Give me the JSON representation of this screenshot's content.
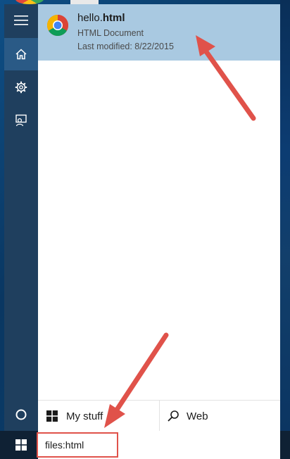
{
  "search_results": {
    "top_result": {
      "title_normal": "hello.",
      "title_bold": "html",
      "type": "HTML Document",
      "last_modified": "Last modified: 8/22/2015",
      "icon": "chrome-icon"
    }
  },
  "rail": {
    "items": [
      {
        "name": "hamburger-menu",
        "icon": "hamburger-icon"
      },
      {
        "name": "home",
        "icon": "home-icon",
        "selected": true
      },
      {
        "name": "settings",
        "icon": "gear-icon"
      },
      {
        "name": "feedback",
        "icon": "feedback-icon"
      }
    ],
    "cortana_icon": "cortana-circle-icon"
  },
  "scopes": {
    "my_stuff_label": "My stuff",
    "web_label": "Web"
  },
  "taskbar": {
    "start_icon": "windows-logo-icon",
    "search_value": "files:html"
  },
  "colors": {
    "result_highlight": "#a9c9e1",
    "rail_background": "#1f3f5e",
    "rail_selected": "#2a5a86",
    "annotation_red": "#e0524a"
  }
}
